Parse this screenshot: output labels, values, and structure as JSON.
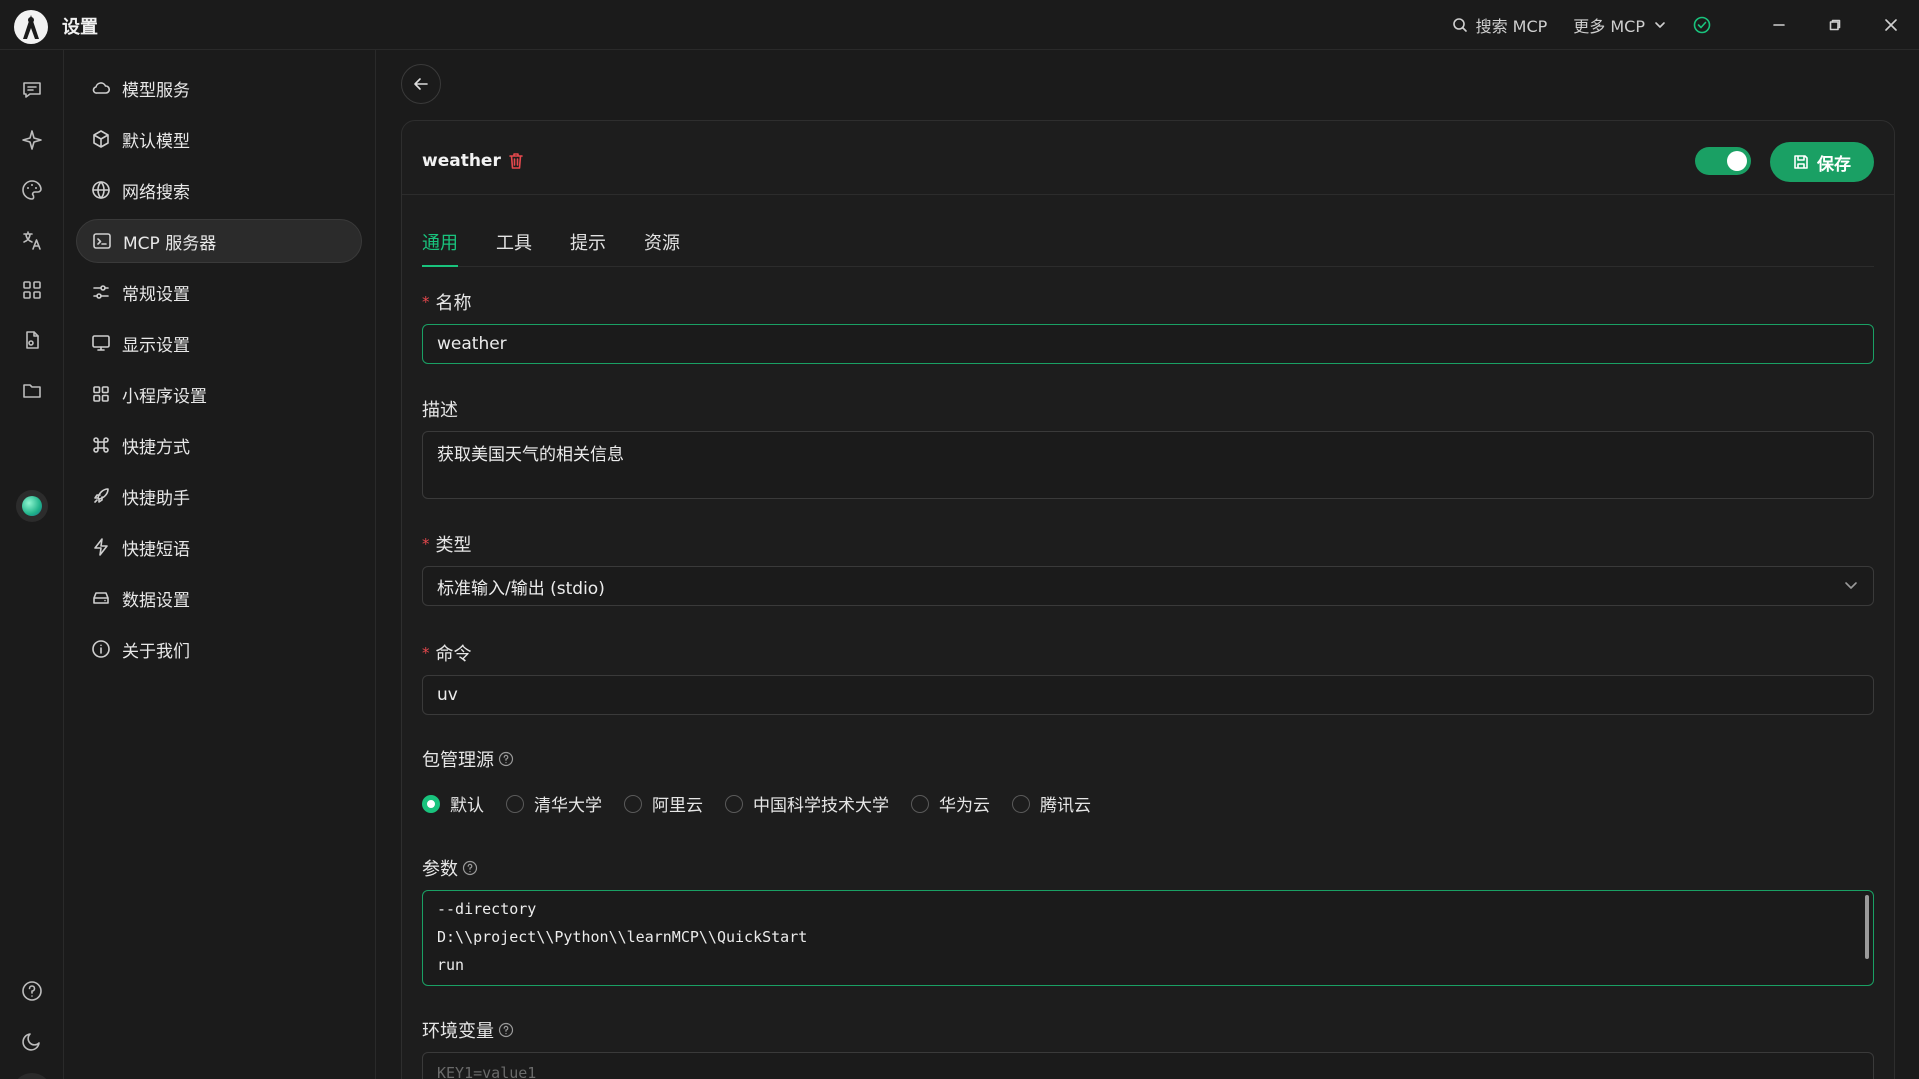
{
  "titlebar": {
    "title": "设置",
    "search_mcp": "搜索 MCP",
    "more_mcp": "更多 MCP"
  },
  "rail": {
    "icons": [
      "chat-icon",
      "sparkle-icon",
      "palette-icon",
      "translate-icon",
      "apps-grid-icon",
      "document-icon",
      "folder-icon",
      "mini-app-icon",
      "help-icon",
      "moon-icon",
      "settings-icon"
    ]
  },
  "menu": {
    "items": [
      {
        "label": "模型服务",
        "icon": "cloud-icon"
      },
      {
        "label": "默认模型",
        "icon": "cube-icon"
      },
      {
        "label": "网络搜索",
        "icon": "globe-icon"
      },
      {
        "label": "MCP 服务器",
        "icon": "terminal-icon",
        "active": true
      },
      {
        "label": "常规设置",
        "icon": "sliders-icon"
      },
      {
        "label": "显示设置",
        "icon": "monitor-icon"
      },
      {
        "label": "小程序设置",
        "icon": "grid-icon"
      },
      {
        "label": "快捷方式",
        "icon": "command-icon"
      },
      {
        "label": "快捷助手",
        "icon": "rocket-icon"
      },
      {
        "label": "快捷短语",
        "icon": "zap-icon"
      },
      {
        "label": "数据设置",
        "icon": "drive-icon"
      },
      {
        "label": "关于我们",
        "icon": "info-icon"
      }
    ]
  },
  "server": {
    "name": "weather",
    "enabled": true,
    "save_label": "保存"
  },
  "tabs": [
    "通用",
    "工具",
    "提示",
    "资源"
  ],
  "form": {
    "name_label": "名称",
    "name_value": "weather",
    "desc_label": "描述",
    "desc_value": "获取美国天气的相关信息",
    "type_label": "类型",
    "type_value": "标准输入/输出 (stdio)",
    "command_label": "命令",
    "command_value": "uv",
    "registry_label": "包管理源",
    "registry_options": [
      "默认",
      "清华大学",
      "阿里云",
      "中国科学技术大学",
      "华为云",
      "腾讯云"
    ],
    "registry_selected": "默认",
    "args_label": "参数",
    "args_lines": [
      "--directory",
      "D:\\\\project\\\\Python\\\\learnMCP\\\\QuickStart",
      "run"
    ],
    "env_label": "环境变量",
    "env_placeholder": "KEY1=value1"
  },
  "colors": {
    "accent": "#19c37d",
    "danger": "#e5484d",
    "background": "#1b1b1b"
  }
}
